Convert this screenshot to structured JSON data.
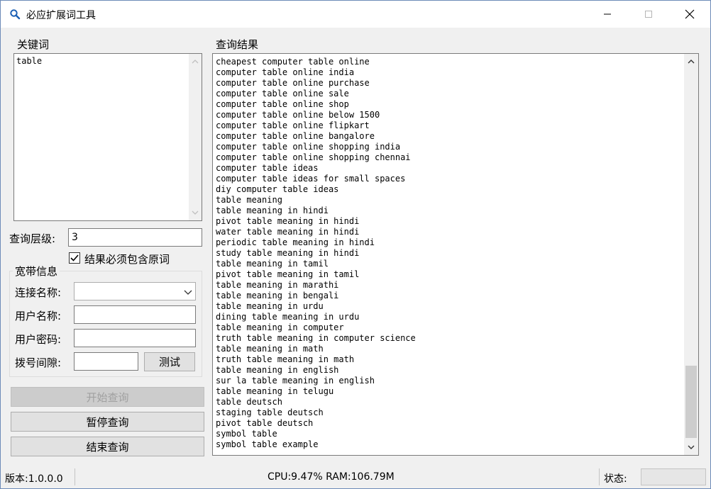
{
  "window": {
    "title": "必应扩展词工具",
    "icon": "search-icon"
  },
  "keywords": {
    "group_label": "关键词",
    "value": "table"
  },
  "query_level": {
    "label": "查询层级:",
    "value": "3"
  },
  "must_contain": {
    "label": "结果必须包含原词",
    "checked": true
  },
  "broadband": {
    "group_label": "宽带信息",
    "connection_label": "连接名称:",
    "connection_value": "",
    "username_label": "用户名称:",
    "username_value": "",
    "password_label": "用户密码:",
    "password_value": "",
    "dial_interval_label": "拨号间隙:",
    "dial_interval_value": "",
    "test_button": "测试"
  },
  "actions": {
    "start": "开始查询",
    "pause": "暂停查询",
    "stop": "结束查询"
  },
  "results": {
    "group_label": "查询结果",
    "items": [
      "cheapest computer table online",
      "computer table online india",
      "computer table online purchase",
      "computer table online sale",
      "computer table online shop",
      "computer table online below 1500",
      "computer table online flipkart",
      "computer table online bangalore",
      "computer table online shopping india",
      "computer table online shopping chennai",
      "computer table ideas",
      "computer table ideas for small spaces",
      "diy computer table ideas",
      "table meaning",
      "table meaning in hindi",
      "pivot table meaning in hindi",
      "water table meaning in hindi",
      "periodic table meaning in hindi",
      "study table meaning in hindi",
      "table meaning in tamil",
      "pivot table meaning in tamil",
      "table meaning in marathi",
      "table meaning in bengali",
      "table meaning in urdu",
      "dining table meaning in urdu",
      "table meaning in computer",
      "truth table meaning in computer science",
      "table meaning in math",
      "truth table meaning in math",
      "table meaning in english",
      "sur la table meaning in english",
      "table meaning in telugu",
      "table deutsch",
      "staging table deutsch",
      "pivot table deutsch",
      "symbol table",
      "symbol table example"
    ]
  },
  "status": {
    "version": "版本:1.0.0.0",
    "resources": "CPU:9.47% RAM:106.79M",
    "state_label": "状态:",
    "state_value": ""
  }
}
